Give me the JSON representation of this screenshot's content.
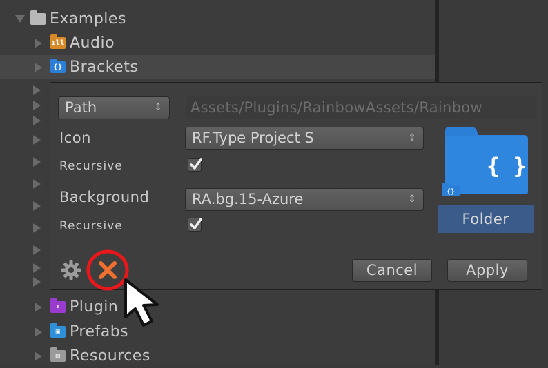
{
  "tree": {
    "root": {
      "label": "Examples",
      "expanded": true
    },
    "items_top": [
      {
        "label": "Audio",
        "icon": "audio-folder-icon"
      },
      {
        "label": "Brackets",
        "icon": "brackets-folder-icon",
        "selected": true
      }
    ],
    "items_bottom": [
      {
        "label": "Plugin"
      },
      {
        "label": "Prefabs"
      },
      {
        "label": "Resources"
      }
    ]
  },
  "dialog": {
    "mode_dropdown": "Path",
    "path_value": "Assets/Plugins/RainbowAssets/Rainbow",
    "icon_label": "Icon",
    "icon_value": "RF.Type Project S",
    "icon_recursive_label": "Recursive",
    "icon_recursive_checked": true,
    "background_label": "Background",
    "background_value": "RA.bg.15-Azure",
    "background_recursive_label": "Recursive",
    "background_recursive_checked": true,
    "preview_name": "Folder",
    "preview_glyph": "{ }",
    "cancel_label": "Cancel",
    "apply_label": "Apply"
  },
  "colors": {
    "folder_blue": "#2b7fd6",
    "highlight_red": "#e8171b",
    "delete_orange": "#f07030"
  }
}
